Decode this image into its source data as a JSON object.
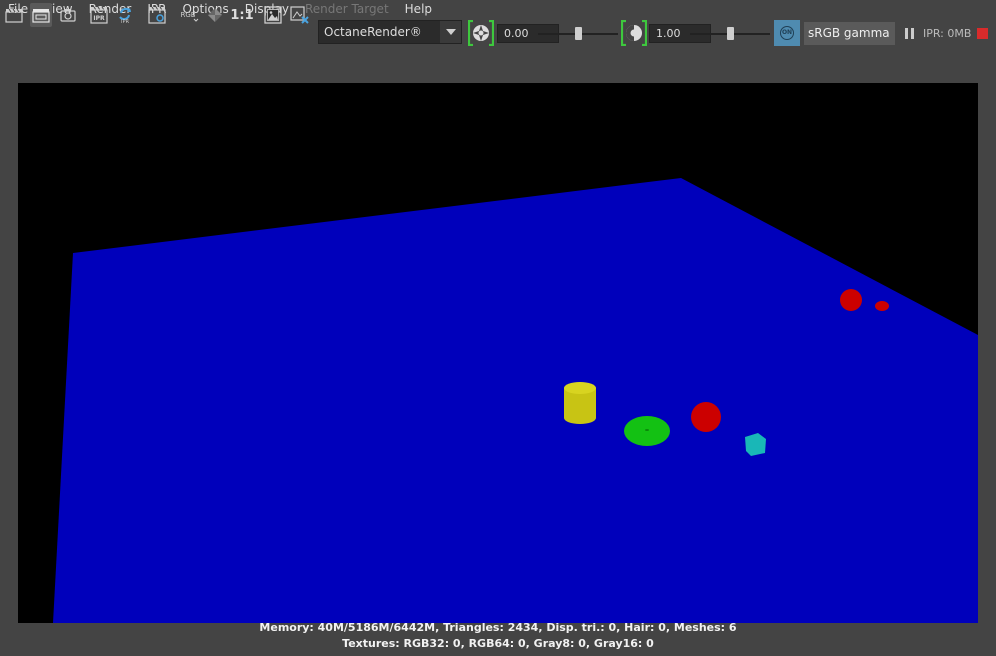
{
  "menu": {
    "items": [
      "File",
      "View",
      "Render",
      "IPR",
      "Options",
      "Display",
      "Render Target",
      "Help"
    ],
    "disabled": [
      false,
      false,
      false,
      false,
      false,
      false,
      true,
      false
    ]
  },
  "toolbar": {
    "icons": {
      "clapper_label": "clapper-icon",
      "ipr_label": "IPR",
      "rgb_label": "RGB",
      "ratio_label": "1:1"
    },
    "renderer": {
      "value": "OctaneRender®"
    },
    "exposure": {
      "value": "0.00",
      "fraction": 0.5
    },
    "gamma": {
      "value": "1.00",
      "fraction": 0.5
    },
    "color_management_badge": "ON",
    "color_space": "sRGB gamma",
    "ipr_status": "IPR: 0MB",
    "bracket_color": "#3ec83e",
    "stop_color": "#d92b2b"
  },
  "render": {
    "background_color": "#000000",
    "plane_color": "#0000bb",
    "objects": [
      {
        "name": "yellow-cylinder",
        "color": "#c8c414"
      },
      {
        "name": "green-disc",
        "color": "#13c113"
      },
      {
        "name": "red-sphere",
        "color": "#cc0000"
      },
      {
        "name": "cyan-box",
        "color": "#19b7b7"
      },
      {
        "name": "far-red-sphere",
        "color": "#cc0000"
      },
      {
        "name": "far-red-box",
        "color": "#cc0000"
      }
    ]
  },
  "stats": {
    "line1": "Memory: 40M/5186M/6442M, Triangles: 2434, Disp. tri.: 0, Hair: 0, Meshes: 6",
    "line2": "Textures: RGB32: 0, RGB64: 0, Gray8: 0, Gray16: 0"
  }
}
